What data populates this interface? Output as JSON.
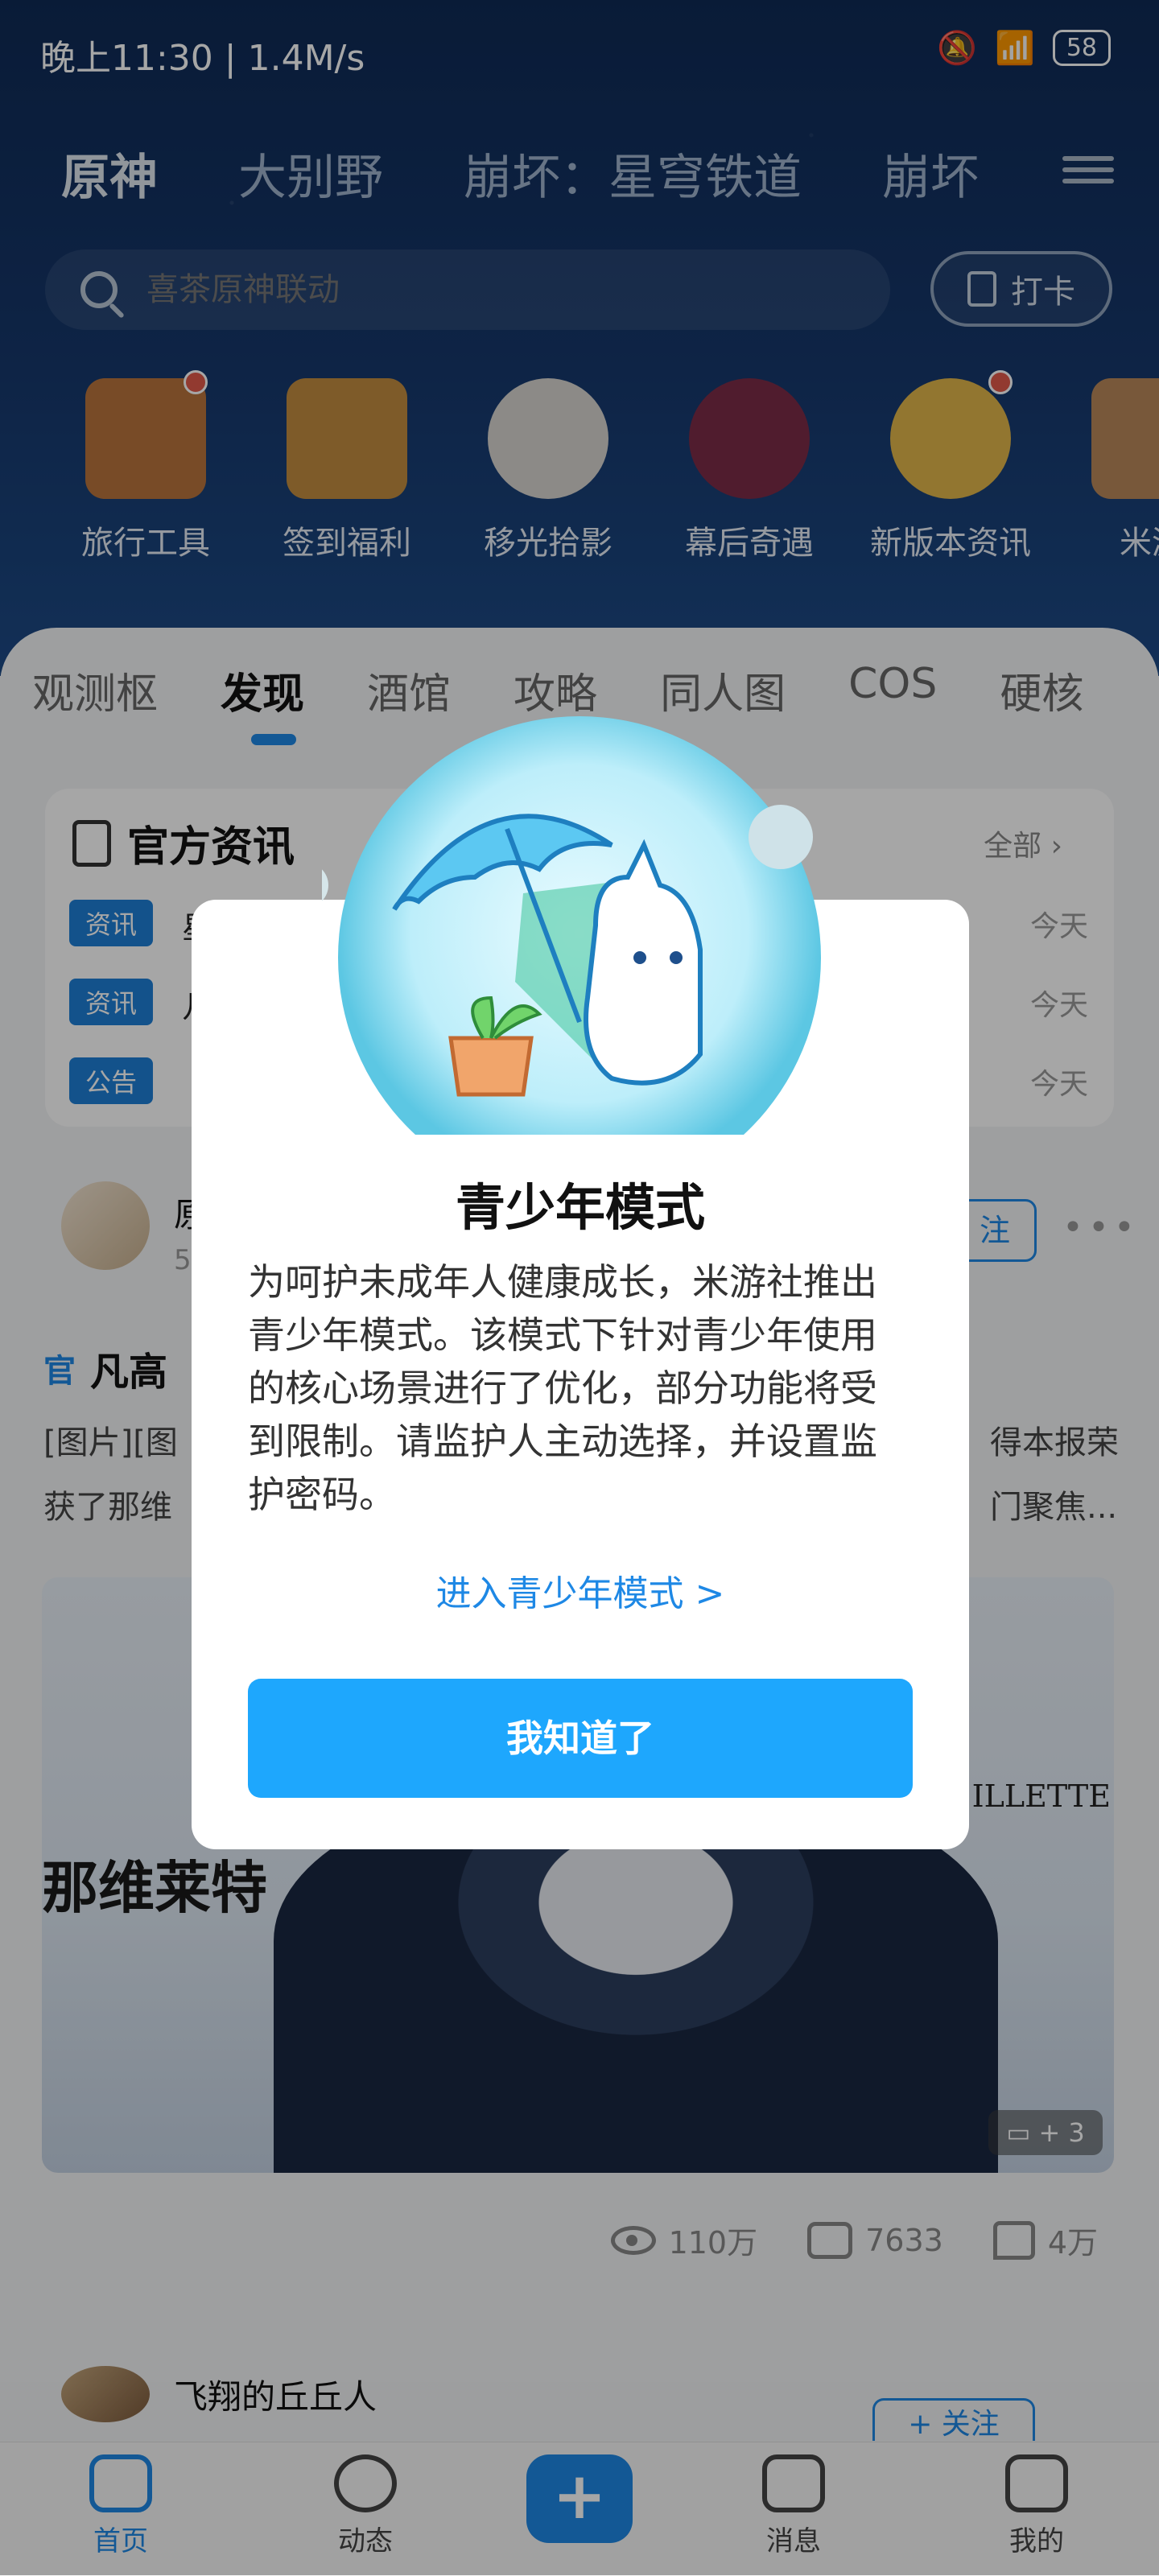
{
  "status_bar": {
    "left": "晚上11:30 | 1.4M/s",
    "battery": "58"
  },
  "top_nav": {
    "items": [
      "原神",
      "大别野",
      "崩坏：星穹铁道",
      "崩坏"
    ]
  },
  "search": {
    "placeholder": "喜茶原神联动",
    "checkin_label": "打卡"
  },
  "shortcuts": [
    {
      "label": "旅行工具",
      "color": "#b8743c"
    },
    {
      "label": "签到福利",
      "color": "#c28c3f"
    },
    {
      "label": "移光拾影",
      "color": "#d8d5cf"
    },
    {
      "label": "幕后奇遇",
      "color": "#7b2c48"
    },
    {
      "label": "新版本资讯",
      "color": "#e0b54a"
    },
    {
      "label": "米游",
      "color": "#b9875a"
    }
  ],
  "tabs": [
    "观测枢",
    "发现",
    "酒馆",
    "攻略",
    "同人图",
    "COS",
    "硬核"
  ],
  "news": {
    "title": "官方资讯",
    "all_label": "全部",
    "rows": [
      {
        "tag": "资讯",
        "text": "星",
        "time": "今天"
      },
      {
        "tag": "资讯",
        "text": "几",
        "time": "今天"
      },
      {
        "tag": "公告",
        "text": "",
        "time": "今天"
      }
    ]
  },
  "post": {
    "author_initial": "原",
    "author_sub": "5",
    "follow_label": "注",
    "official_tag": "官",
    "title": "凡高",
    "snippet_line1": "[图片][图",
    "snippet_line1_end": "得本报荣",
    "snippet_line2": "获了那维",
    "snippet_line2_end": "门聚焦...",
    "image_title": "那维莱特",
    "image_name_en": "ILLETTE",
    "image_count": "+ 3",
    "views": "110万",
    "comments": "7633",
    "likes": "4万"
  },
  "next_post": {
    "username": "飞翔的丘丘人",
    "follow_label": "+ 关注"
  },
  "tab_bar": {
    "home": "首页",
    "dynamic": "动态",
    "plus": "+",
    "messages": "消息",
    "mine": "我的"
  },
  "modal": {
    "title": "青少年模式",
    "body": "为呵护未成年人健康成长，米游社推出青少年模式。该模式下针对青少年使用的核心场景进行了优化，部分功能将受到限制。请监护人主动选择，并设置监护密码。",
    "link": "进入青少年模式 >",
    "confirm": "我知道了"
  }
}
